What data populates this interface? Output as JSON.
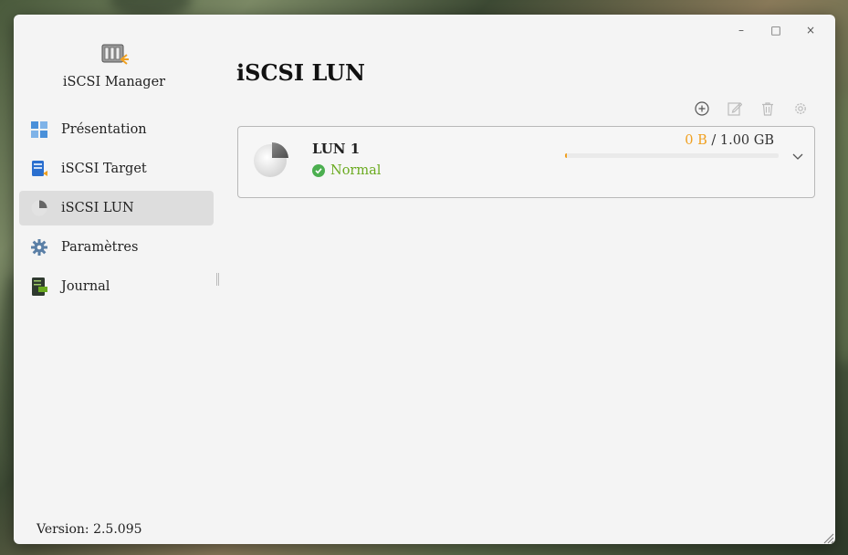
{
  "window": {
    "controls": {
      "minimize": "–",
      "maximize": "□",
      "close": "×"
    }
  },
  "sidebar": {
    "app_name": "iSCSI Manager",
    "items": [
      {
        "label": "Présentation",
        "icon": "overview-icon"
      },
      {
        "label": "iSCSI Target",
        "icon": "target-icon"
      },
      {
        "label": "iSCSI LUN",
        "icon": "lun-icon",
        "active": true
      },
      {
        "label": "Paramètres",
        "icon": "gear-icon"
      },
      {
        "label": "Journal",
        "icon": "log-icon"
      }
    ],
    "version": "Version: 2.5.095"
  },
  "main": {
    "title": "iSCSI LUN",
    "toolbar": [
      "add-icon",
      "edit-icon",
      "delete-icon",
      "settings-icon"
    ],
    "luns": [
      {
        "name": "LUN 1",
        "status": "Normal",
        "used": "0 B",
        "separator": " / ",
        "total": "1.00 GB",
        "usage_fraction": 0.0
      }
    ]
  },
  "colors": {
    "accent_orange": "#f0a020",
    "status_green": "#6aaa1f",
    "active_bg": "#dddddd"
  }
}
